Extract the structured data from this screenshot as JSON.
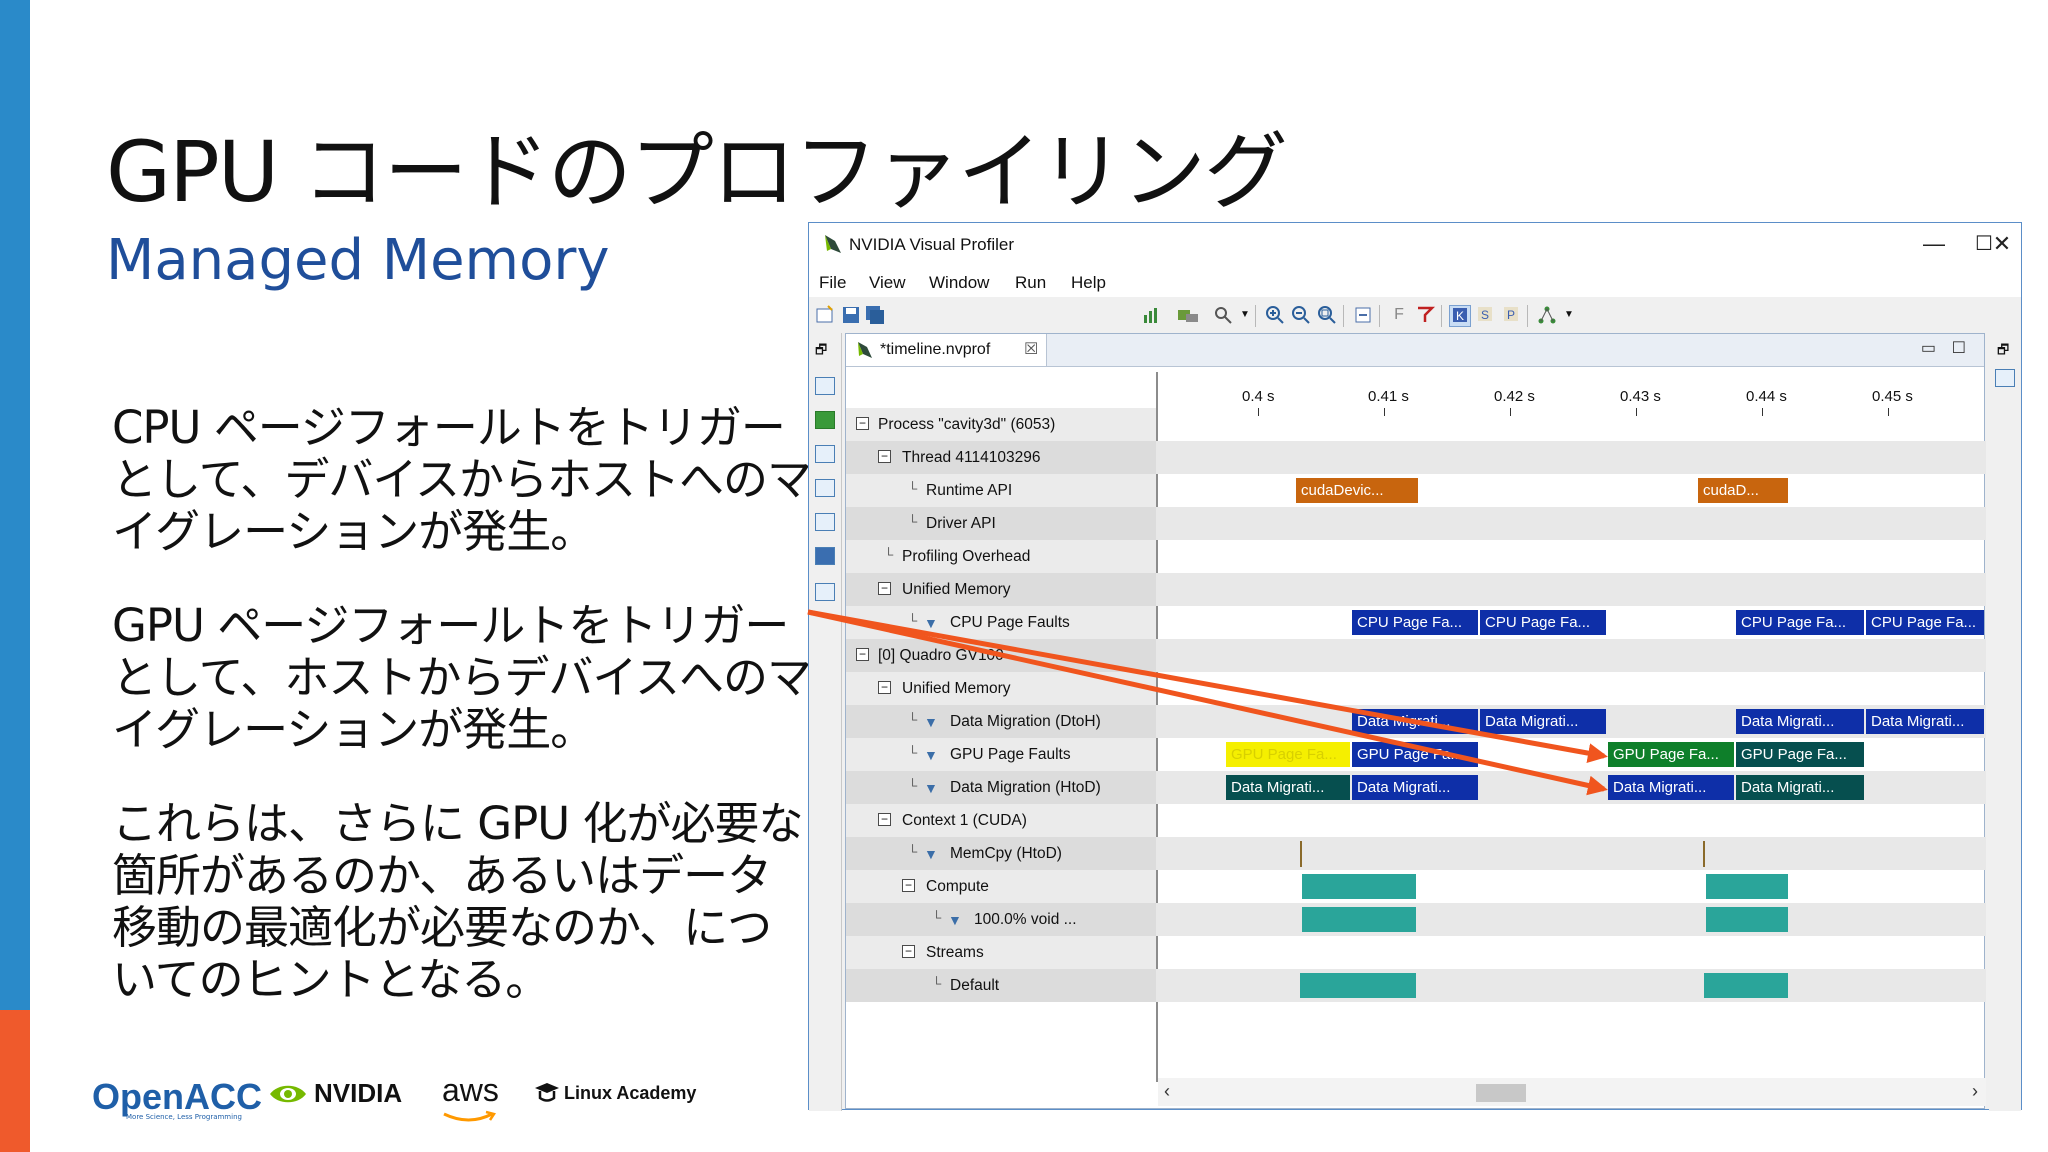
{
  "slide": {
    "title": "GPU コードのプロファイリング",
    "subtitle": "Managed Memory",
    "paragraph1": "CPU ページフォールトをトリガーとして、デバイスからホストへのマイグレーションが発生。",
    "paragraph2": "GPU ページフォールトをトリガーとして、ホストからデバイスへのマイグレーションが発生。",
    "paragraph3": "これらは、さらに GPU 化が必要な箇所があるのか、あるいはデータ移動の最適化が必要なのか、についてのヒントとなる。",
    "colors": {
      "title": "#111111",
      "subtitle": "#1f4e9a",
      "left_bar_blue": "#2a8ac9",
      "left_bar_orange": "#ef5a2c",
      "arrow": "#f0551e"
    }
  },
  "logos": {
    "openacc": "OpenACC",
    "openacc_tagline": "More Science, Less Programming",
    "nvidia": "NVIDIA",
    "aws": "aws",
    "linux_academy": "Linux Academy"
  },
  "window": {
    "title": "NVIDIA Visual Profiler",
    "minimize": "—",
    "maximize": "☐",
    "close": "✕",
    "menu": [
      "File",
      "View",
      "Window",
      "Run",
      "Help"
    ],
    "tab_label": "*timeline.nvprof",
    "tab_close": "☒"
  },
  "timeline": {
    "ticks": [
      "0.4 s",
      "0.41 s",
      "0.42 s",
      "0.43 s",
      "0.44 s",
      "0.45 s"
    ],
    "rows": [
      {
        "label": "Process \"cavity3d\" (6053)",
        "type": "expander"
      },
      {
        "label": "Thread 4114103296",
        "type": "expander"
      },
      {
        "label": "Runtime API",
        "type": "leaf"
      },
      {
        "label": "Driver API",
        "type": "leaf"
      },
      {
        "label": "Profiling Overhead",
        "type": "leaf"
      },
      {
        "label": "Unified Memory",
        "type": "expander"
      },
      {
        "label": "CPU Page Faults",
        "type": "filter"
      },
      {
        "label": "[0] Quadro GV100",
        "type": "expander"
      },
      {
        "label": "Unified Memory",
        "type": "expander"
      },
      {
        "label": "Data Migration (DtoH)",
        "type": "filter"
      },
      {
        "label": "GPU Page Faults",
        "type": "filter"
      },
      {
        "label": "Data Migration (HtoD)",
        "type": "filter"
      },
      {
        "label": "Context 1 (CUDA)",
        "type": "expander"
      },
      {
        "label": "MemCpy (HtoD)",
        "type": "filter"
      },
      {
        "label": "Compute",
        "type": "expander"
      },
      {
        "label": "100.0% void ...",
        "type": "filter"
      },
      {
        "label": "Streams",
        "type": "expander"
      },
      {
        "label": "Default",
        "type": "leaf"
      }
    ],
    "bars": {
      "runtime": [
        "cudaDevic...",
        "cudaD..."
      ],
      "cpu_faults": [
        "CPU Page Fa...",
        "CPU Page Fa...",
        "CPU Page Fa...",
        "CPU Page Fa..."
      ],
      "dtoh": [
        "Data Migrati...",
        "Data Migrati...",
        "Data Migrati...",
        "Data Migrati..."
      ],
      "gpu_faults": [
        "GPU Page Fa...",
        "GPU Page Fa...",
        "GPU Page Fa...",
        "GPU Page Fa..."
      ],
      "htod": [
        "Data Migrati...",
        "Data Migrati...",
        "Data Migrati...",
        "Data Migrati..."
      ]
    }
  }
}
